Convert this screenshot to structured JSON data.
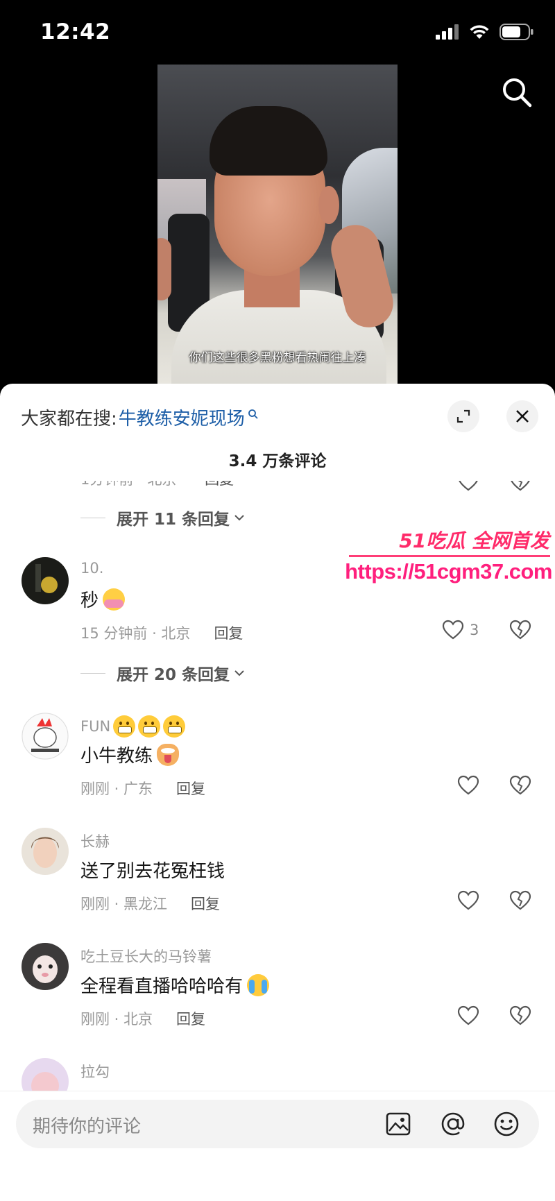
{
  "status_bar": {
    "time": "12:42"
  },
  "video": {
    "subtitle": "你们这些很多黑粉想看热闹往上凑"
  },
  "sheet": {
    "search_prefix": "大家都在搜:",
    "search_keyword": "牛教练安妮现场",
    "comment_count": "3.4 万条评论",
    "partial_meta": {
      "time_loc": "1分钟前 · 北京",
      "reply": "回复"
    },
    "expand_rows": [
      "展开 11 条回复",
      "展开 20 条回复"
    ],
    "comments": [
      {
        "user": "10.",
        "text": "秒",
        "time_loc": "15 分钟前 · 北京",
        "reply": "回复",
        "likes": "3"
      },
      {
        "user": "FUN",
        "text": "小牛教练",
        "time_loc": "刚刚 · 广东",
        "reply": "回复",
        "likes": ""
      },
      {
        "user": "长赫",
        "text": "送了别去花冤枉钱",
        "time_loc": "刚刚 · 黑龙江",
        "reply": "回复",
        "likes": ""
      },
      {
        "user": "吃土豆长大的马铃薯",
        "text": "全程看直播哈哈哈有",
        "time_loc": "刚刚 · 北京",
        "reply": "回复",
        "likes": ""
      },
      {
        "user": "拉勾"
      }
    ]
  },
  "watermark": {
    "brand": "51吃瓜 全网首发",
    "url": "https://51cgm37.com"
  },
  "input": {
    "placeholder": "期待你的评论"
  },
  "colors": {
    "keyword": "#1d5ea7",
    "watermark": "#ff1f7d",
    "meta": "#999999"
  }
}
